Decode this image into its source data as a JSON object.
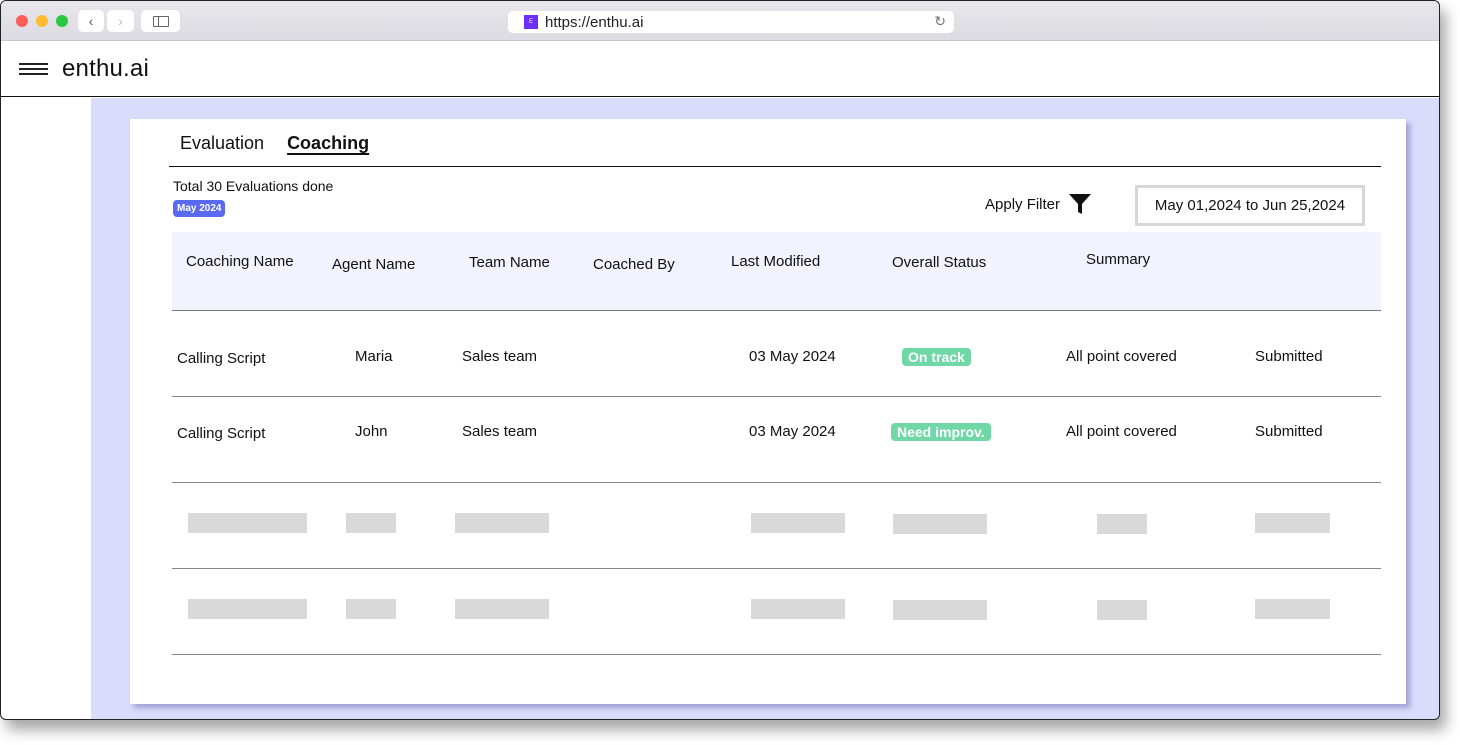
{
  "browser": {
    "url": "https://enthu.ai",
    "favicon_letter": "E",
    "icons": {
      "back": "chevron-left-icon",
      "forward": "chevron-right-icon",
      "sidebar": "sidebar-toggle-icon",
      "reload": "reload-icon"
    }
  },
  "app": {
    "brand": "enthu.ai",
    "menu_icon": "hamburger-menu-icon"
  },
  "tabs": [
    {
      "label": "Evaluation",
      "active": false
    },
    {
      "label": "Coaching",
      "active": true
    }
  ],
  "summary": {
    "total_text": "Total 30 Evaluations done",
    "month_badge": "May 2024",
    "month_badge_color": "#5a6af0"
  },
  "filter": {
    "label": "Apply Filter",
    "icon": "filter-funnel-icon",
    "date_range": "May 01,2024 to Jun 25,2024"
  },
  "table": {
    "columns": [
      "Coaching Name",
      "Agent Name",
      "Team Name",
      "Coached By",
      "Last Modified",
      "Overall Status",
      "Summary"
    ],
    "rows": [
      {
        "coaching_name": "Calling Script",
        "agent_name": "Maria",
        "team_name": "Sales team",
        "coached_by": "",
        "last_modified": "03 May 2024",
        "overall_status": "On track",
        "summary": "All point covered",
        "state": "Submitted"
      },
      {
        "coaching_name": "Calling Script",
        "agent_name": "John",
        "team_name": "Sales team",
        "coached_by": "",
        "last_modified": "03 May 2024",
        "overall_status": "Need improv.",
        "summary": "All point covered",
        "state": "Submitted"
      }
    ],
    "placeholder_rows": 2,
    "status_color": "#6fd8a6"
  }
}
